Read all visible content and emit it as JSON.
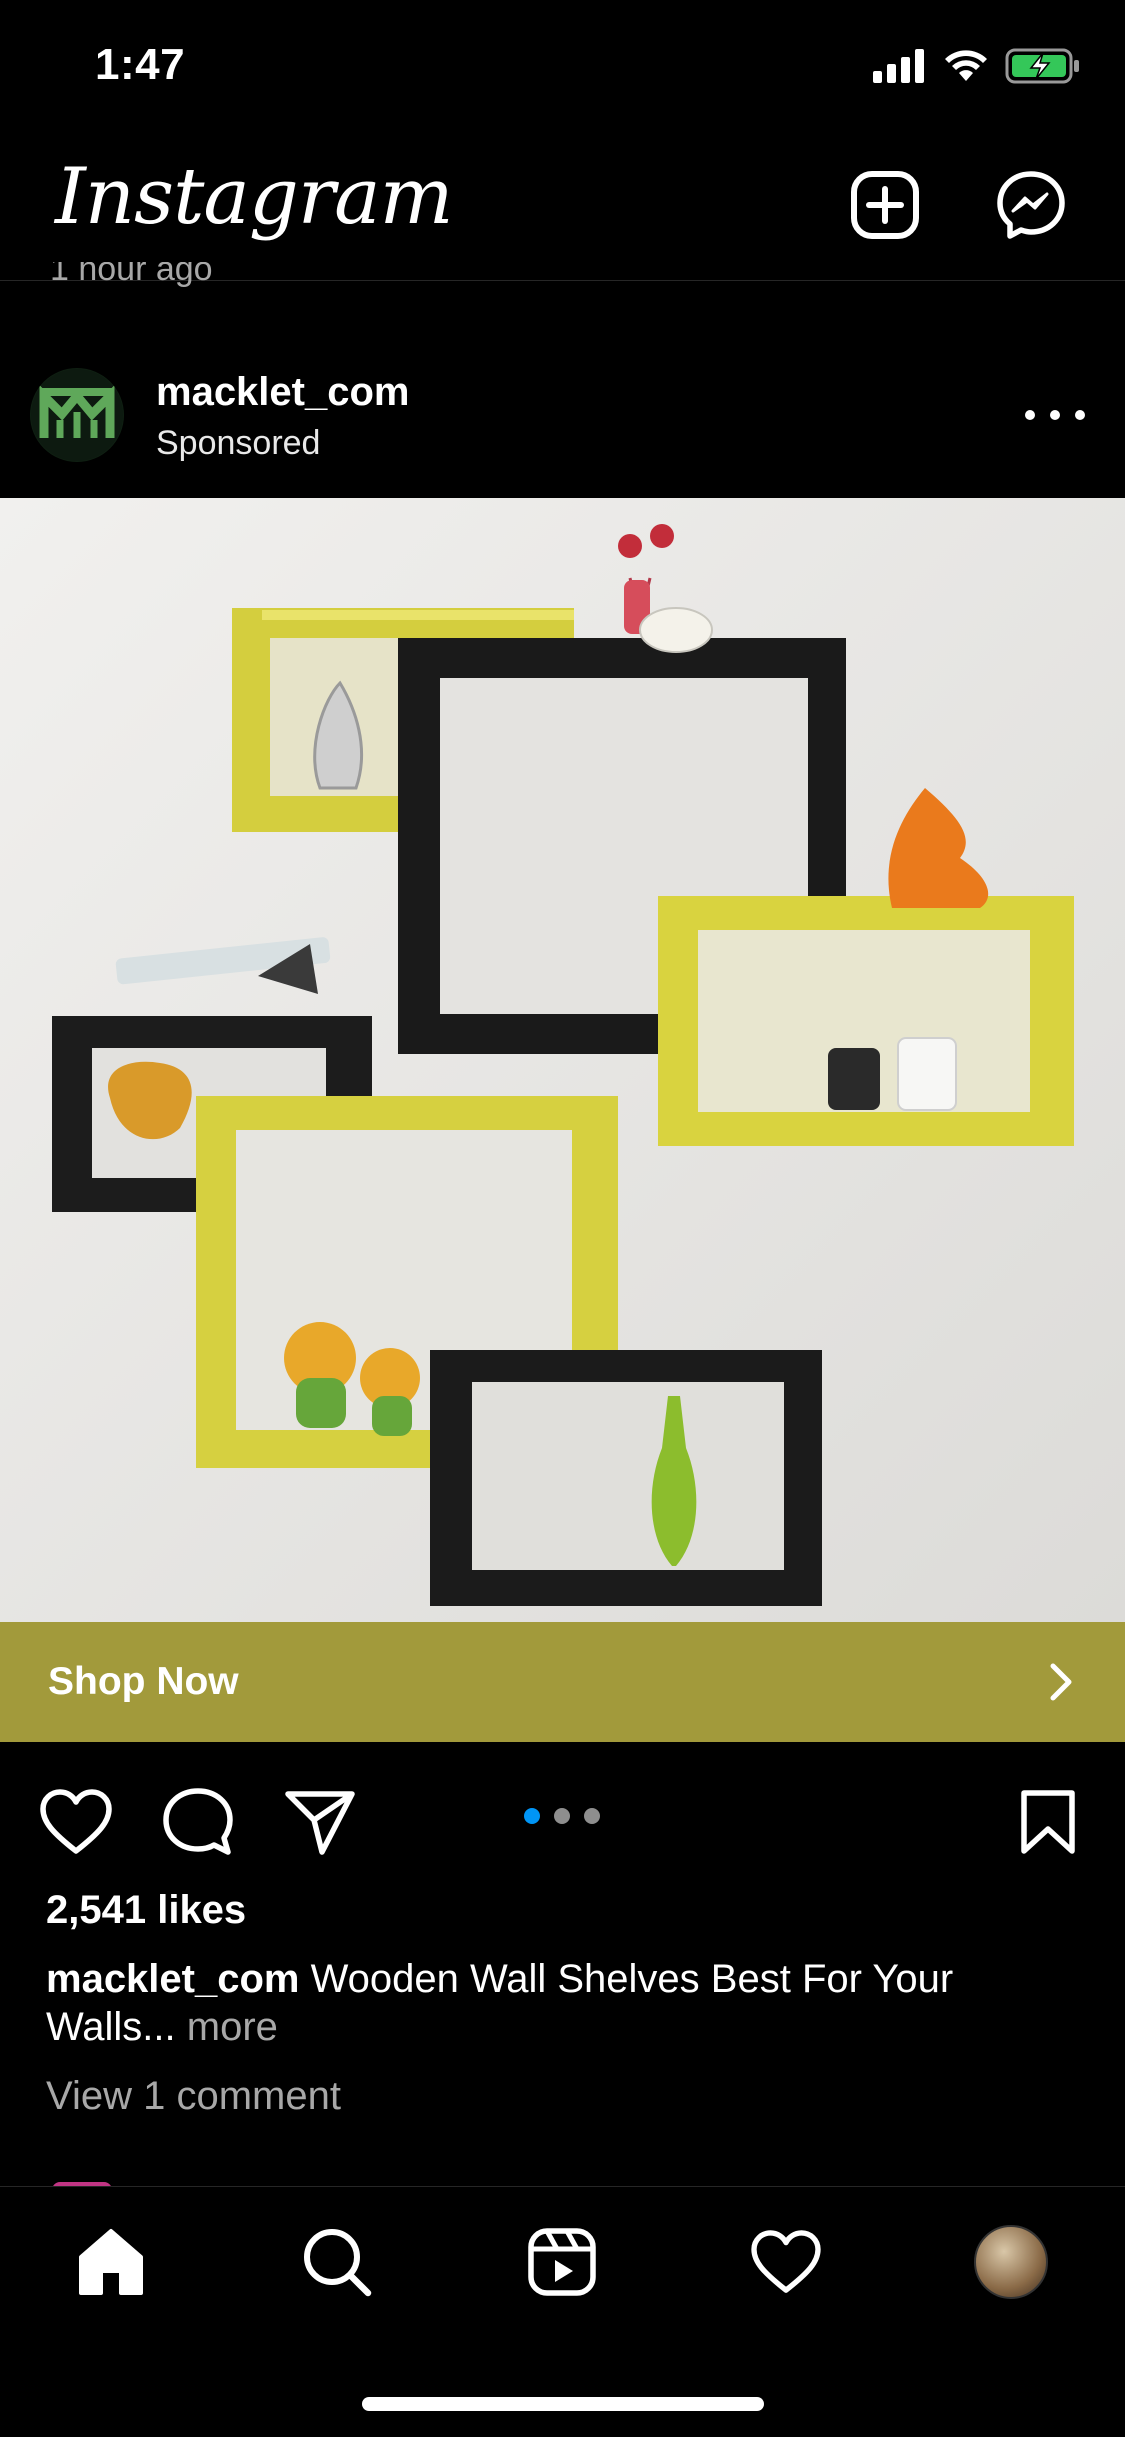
{
  "status_bar": {
    "time": "1:47"
  },
  "header": {
    "logo": "Instagram",
    "new_post_icon": "plus-square-icon",
    "messenger_icon": "messenger-icon"
  },
  "previous_post": {
    "time_partial": "1 hour ago"
  },
  "post": {
    "username": "macklet_com",
    "sponsored_label": "Sponsored",
    "image_description_icon": "wall-shelves-photo",
    "cta": {
      "label": "Shop Now"
    },
    "carousel": {
      "count": 3,
      "active_index": 0
    },
    "likes": "2,541 likes",
    "caption": {
      "user": "macklet_com",
      "text": " Wooden Wall Shelves Best For Your Walls...",
      "more": " more"
    },
    "view_comments": "View 1 comment"
  },
  "colors": {
    "cta_bg": "#a29a3b",
    "active_dot": "#0095f6",
    "inactive_dot": "#8e8e8e",
    "brand_green": "#5fa85a"
  },
  "bottom_nav": {
    "items": [
      "home-icon",
      "search-icon",
      "reels-icon",
      "heart-icon",
      "profile-avatar"
    ]
  }
}
